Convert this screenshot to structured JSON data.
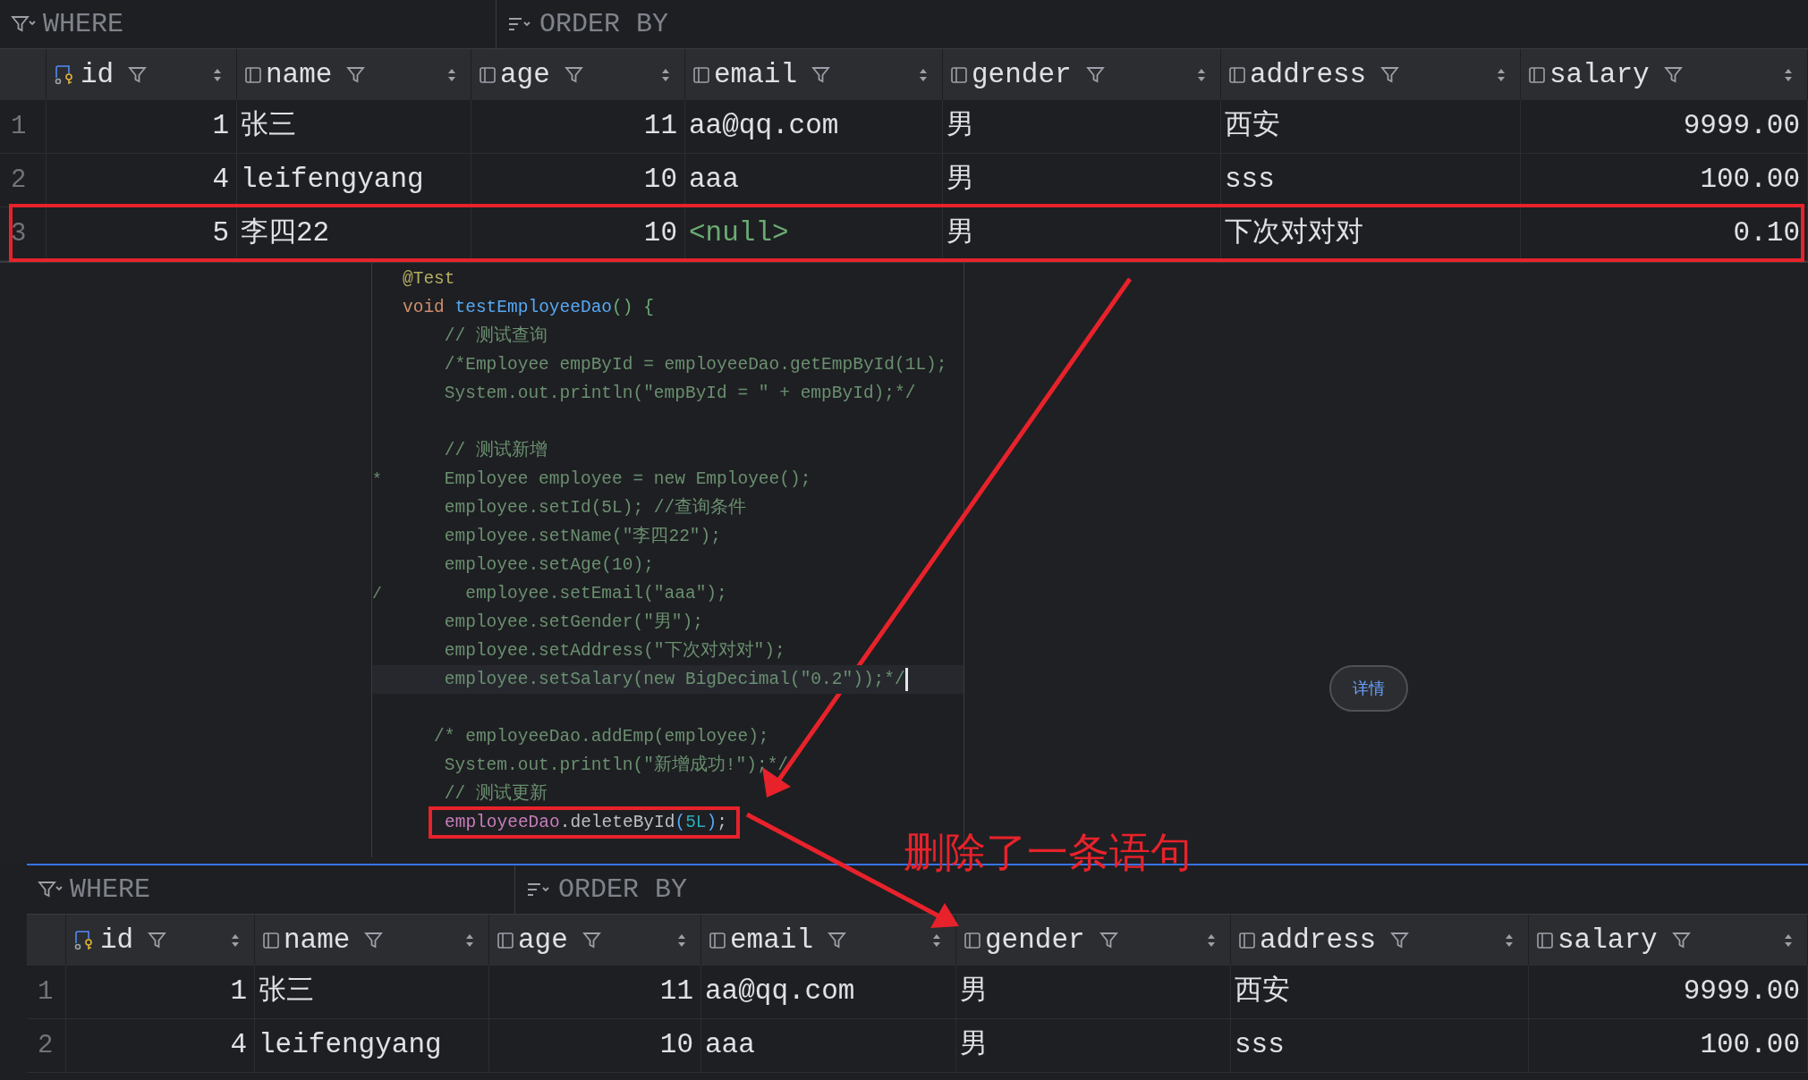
{
  "top_table": {
    "toolbar": {
      "where": "WHERE",
      "order_by": "ORDER BY"
    },
    "columns": [
      {
        "label": "id",
        "kind": "key",
        "numeric": true
      },
      {
        "label": "name",
        "kind": "column",
        "numeric": false
      },
      {
        "label": "age",
        "kind": "column",
        "numeric": true
      },
      {
        "label": "email",
        "kind": "column",
        "numeric": false
      },
      {
        "label": "gender",
        "kind": "column",
        "numeric": false
      },
      {
        "label": "address",
        "kind": "column",
        "numeric": false
      },
      {
        "label": "salary",
        "kind": "column",
        "numeric": true
      }
    ],
    "rows": [
      {
        "number": "1",
        "highlighted": false,
        "cells": [
          {
            "text": "1",
            "kind": "value"
          },
          {
            "text": "张三",
            "kind": "value"
          },
          {
            "text": "11",
            "kind": "value"
          },
          {
            "text": "aa@qq.com",
            "kind": "value"
          },
          {
            "text": "男",
            "kind": "value"
          },
          {
            "text": "西安",
            "kind": "value"
          },
          {
            "text": "9999.00",
            "kind": "value"
          }
        ]
      },
      {
        "number": "2",
        "highlighted": false,
        "cells": [
          {
            "text": "4",
            "kind": "value"
          },
          {
            "text": "leifengyang",
            "kind": "value"
          },
          {
            "text": "10",
            "kind": "value"
          },
          {
            "text": "aaa",
            "kind": "value"
          },
          {
            "text": "男",
            "kind": "value"
          },
          {
            "text": "sss",
            "kind": "value"
          },
          {
            "text": "100.00",
            "kind": "value"
          }
        ]
      },
      {
        "number": "3",
        "highlighted": true,
        "cells": [
          {
            "text": "5",
            "kind": "value"
          },
          {
            "text": "李四22",
            "kind": "value"
          },
          {
            "text": "10",
            "kind": "value"
          },
          {
            "text": "<null>",
            "kind": "null"
          },
          {
            "text": "男",
            "kind": "value"
          },
          {
            "text": "下次对对对",
            "kind": "value"
          },
          {
            "text": "0.10",
            "kind": "value"
          }
        ]
      }
    ]
  },
  "editor": {
    "lines": [
      {
        "kind": "code",
        "tokens": [
          {
            "text": "@Test",
            "kind": "annotation"
          }
        ]
      },
      {
        "tokens": [
          {
            "text": "void",
            "kind": "keyword"
          },
          {
            "text": " testEmployeeDao",
            "kind": "function"
          },
          {
            "text": "() {",
            "kind": "bracket"
          }
        ]
      },
      {
        "tokens": [
          {
            "text": "    // 测试查询",
            "kind": "comment"
          }
        ]
      },
      {
        "tokens": [
          {
            "text": "    /*Employee empById = employeeDao.getEmpById(1L);",
            "kind": "comment"
          }
        ]
      },
      {
        "tokens": [
          {
            "text": "    System.out.println(\"empById = \" + empById);*/",
            "kind": "comment"
          }
        ]
      },
      {
        "kind": "blank"
      },
      {
        "tokens": [
          {
            "text": "    // 测试新增",
            "kind": "comment"
          }
        ]
      },
      {
        "gutter": "*",
        "tokens": [
          {
            "text": "    Employee employee = new Employee();",
            "kind": "comment"
          }
        ]
      },
      {
        "tokens": [
          {
            "text": "    employee.setId(5L); //查询条件",
            "kind": "comment"
          }
        ]
      },
      {
        "tokens": [
          {
            "text": "    employee.setName(\"李四22\");",
            "kind": "comment"
          }
        ]
      },
      {
        "tokens": [
          {
            "text": "    employee.setAge(10);",
            "kind": "comment"
          }
        ]
      },
      {
        "gutter": "/",
        "tokens": [
          {
            "text": "      employee.setEmail(\"aaa\");",
            "kind": "comment"
          }
        ]
      },
      {
        "tokens": [
          {
            "text": "    employee.setGender(\"男\");",
            "kind": "comment"
          }
        ]
      },
      {
        "tokens": [
          {
            "text": "    employee.setAddress(\"下次对对对\");",
            "kind": "comment"
          }
        ]
      },
      {
        "current": true,
        "caret": true,
        "tokens": [
          {
            "text": "    employee.setSalary(new BigDecimal(\"0.2\"));*/",
            "kind": "comment"
          }
        ]
      },
      {
        "kind": "blank"
      },
      {
        "tokens": [
          {
            "text": "   /* employeeDao.addEmp(employee);",
            "kind": "comment"
          }
        ]
      },
      {
        "tokens": [
          {
            "text": "    System.out.println(\"新增成功!\");*/",
            "kind": "comment"
          }
        ]
      },
      {
        "tokens": [
          {
            "text": "    // 测试更新",
            "kind": "comment"
          }
        ]
      },
      {
        "boxed": true,
        "tokens": [
          {
            "text": "employeeDao",
            "kind": "field"
          },
          {
            "text": ".deleteById",
            "kind": "plain"
          },
          {
            "text": "(",
            "kind": "paren"
          },
          {
            "text": "5L",
            "kind": "number"
          },
          {
            "text": ")",
            "kind": "paren"
          },
          {
            "text": ";",
            "kind": "plain"
          }
        ]
      }
    ]
  },
  "details_button": "详情",
  "annotation": "删除了一条语句",
  "bottom_table": {
    "toolbar": {
      "where": "WHERE",
      "order_by": "ORDER BY"
    },
    "columns": [
      {
        "label": "id",
        "kind": "key",
        "numeric": true
      },
      {
        "label": "name",
        "kind": "column",
        "numeric": false
      },
      {
        "label": "age",
        "kind": "column",
        "numeric": true
      },
      {
        "label": "email",
        "kind": "column",
        "numeric": false
      },
      {
        "label": "gender",
        "kind": "column",
        "numeric": false
      },
      {
        "label": "address",
        "kind": "column",
        "numeric": false
      },
      {
        "label": "salary",
        "kind": "column",
        "numeric": true
      }
    ],
    "rows": [
      {
        "number": "1",
        "highlighted": false,
        "cells": [
          {
            "text": "1",
            "kind": "value"
          },
          {
            "text": "张三",
            "kind": "value"
          },
          {
            "text": "11",
            "kind": "value"
          },
          {
            "text": "aa@qq.com",
            "kind": "value"
          },
          {
            "text": "男",
            "kind": "value"
          },
          {
            "text": "西安",
            "kind": "value"
          },
          {
            "text": "9999.00",
            "kind": "value"
          }
        ]
      },
      {
        "number": "2",
        "highlighted": false,
        "cells": [
          {
            "text": "4",
            "kind": "value"
          },
          {
            "text": "leifengyang",
            "kind": "value"
          },
          {
            "text": "10",
            "kind": "value"
          },
          {
            "text": "aaa",
            "kind": "value"
          },
          {
            "text": "男",
            "kind": "value"
          },
          {
            "text": "sss",
            "kind": "value"
          },
          {
            "text": "100.00",
            "kind": "value"
          }
        ]
      }
    ]
  }
}
